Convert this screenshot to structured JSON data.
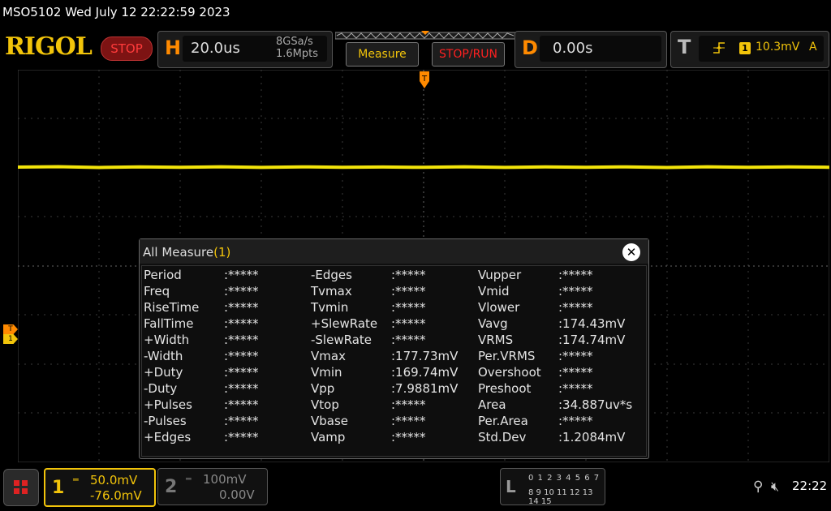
{
  "title_bar": {
    "text": "MSO5102  Wed July 12 22:22:59 2023"
  },
  "logo": {
    "text": "RIGOL"
  },
  "run_state": {
    "label": "STOP"
  },
  "horizontal": {
    "letter": "H",
    "timebase": "20.0us",
    "sample_rate": "8GSa/s",
    "memory_depth": "1.6Mpts"
  },
  "buttons": {
    "measure": "Measure",
    "stop_run": "STOP/RUN"
  },
  "delay": {
    "letter": "D",
    "value": "0.00s"
  },
  "trigger": {
    "letter": "T",
    "source": "1",
    "level": "10.3mV",
    "mode": "A"
  },
  "markers": {
    "trigger": "T",
    "channel1": "1"
  },
  "measure_panel": {
    "title": "All Measure",
    "count": "(1)",
    "close": "✕",
    "rows": [
      [
        "Period",
        ":*****",
        "-Edges",
        ":*****",
        "Vupper",
        ":*****"
      ],
      [
        "Freq",
        ":*****",
        "Tvmax",
        ":*****",
        "Vmid",
        ":*****"
      ],
      [
        "RiseTime",
        ":*****",
        "Tvmin",
        ":*****",
        "Vlower",
        ":*****"
      ],
      [
        "FallTime",
        ":*****",
        "+SlewRate",
        ":*****",
        "Vavg",
        ":174.43mV"
      ],
      [
        "+Width",
        ":*****",
        "-SlewRate",
        ":*****",
        "VRMS",
        ":174.74mV"
      ],
      [
        "-Width",
        ":*****",
        "Vmax",
        ":177.73mV",
        "Per.VRMS",
        ":*****"
      ],
      [
        "+Duty",
        ":*****",
        "Vmin",
        ":169.74mV",
        "Overshoot",
        ":*****"
      ],
      [
        "-Duty",
        ":*****",
        "Vpp",
        ":7.9881mV",
        "Preshoot",
        ":*****"
      ],
      [
        "+Pulses",
        ":*****",
        "Vtop",
        ":*****",
        "Area",
        ":34.887uv*s"
      ],
      [
        "-Pulses",
        ":*****",
        "Vbase",
        ":*****",
        "Per.Area",
        ":*****"
      ],
      [
        "+Edges",
        ":*****",
        "Vamp",
        ":*****",
        "Std.Dev",
        ":1.2084mV"
      ]
    ]
  },
  "channel1": {
    "number": "1",
    "scale": "50.0mV",
    "offset": "-76.0mV"
  },
  "channel2": {
    "number": "2",
    "scale": "100mV",
    "offset": "0.00V"
  },
  "logic": {
    "letter": "L",
    "row1": "0 1 2 3  4 5 6 7",
    "row2": "8 9 10 11 12 13 14 15"
  },
  "clock": {
    "time": "22:22"
  },
  "colors": {
    "ch1": "#f2c40a",
    "accent": "#ff8a00",
    "stop": "#ff2020"
  }
}
